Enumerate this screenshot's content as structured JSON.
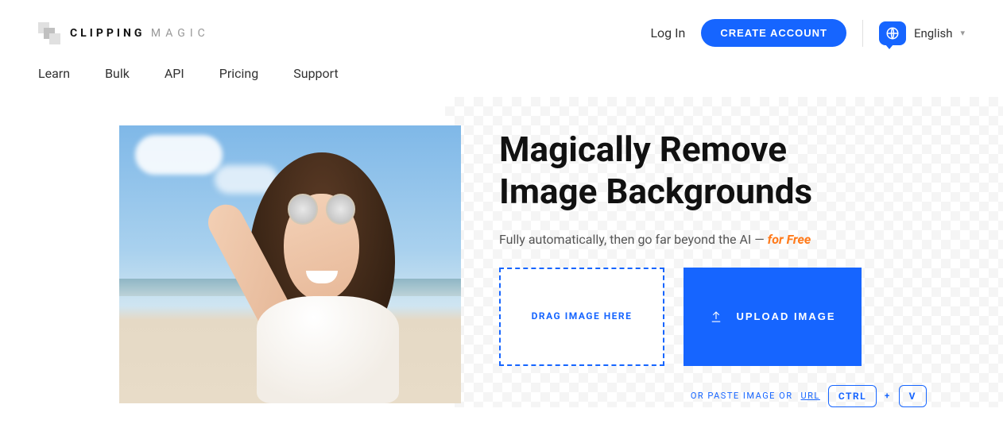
{
  "brand": {
    "part1": "CLIPPING",
    "part2": "MAGIC"
  },
  "header": {
    "login": "Log In",
    "create_account": "CREATE ACCOUNT",
    "language": "English"
  },
  "nav": {
    "learn": "Learn",
    "bulk": "Bulk",
    "api": "API",
    "pricing": "Pricing",
    "support": "Support"
  },
  "hero": {
    "title_line1": "Magically Remove",
    "title_line2": "Image Backgrounds",
    "subtitle_prefix": "Fully automatically, then go far beyond the AI — ",
    "subtitle_free": "for Free",
    "drag_label": "DRAG IMAGE HERE",
    "upload_label": "UPLOAD IMAGE",
    "paste_prefix": "OR PASTE IMAGE OR ",
    "paste_url": "URL",
    "key_ctrl": "CTRL",
    "key_plus": "+",
    "key_v": "V"
  }
}
